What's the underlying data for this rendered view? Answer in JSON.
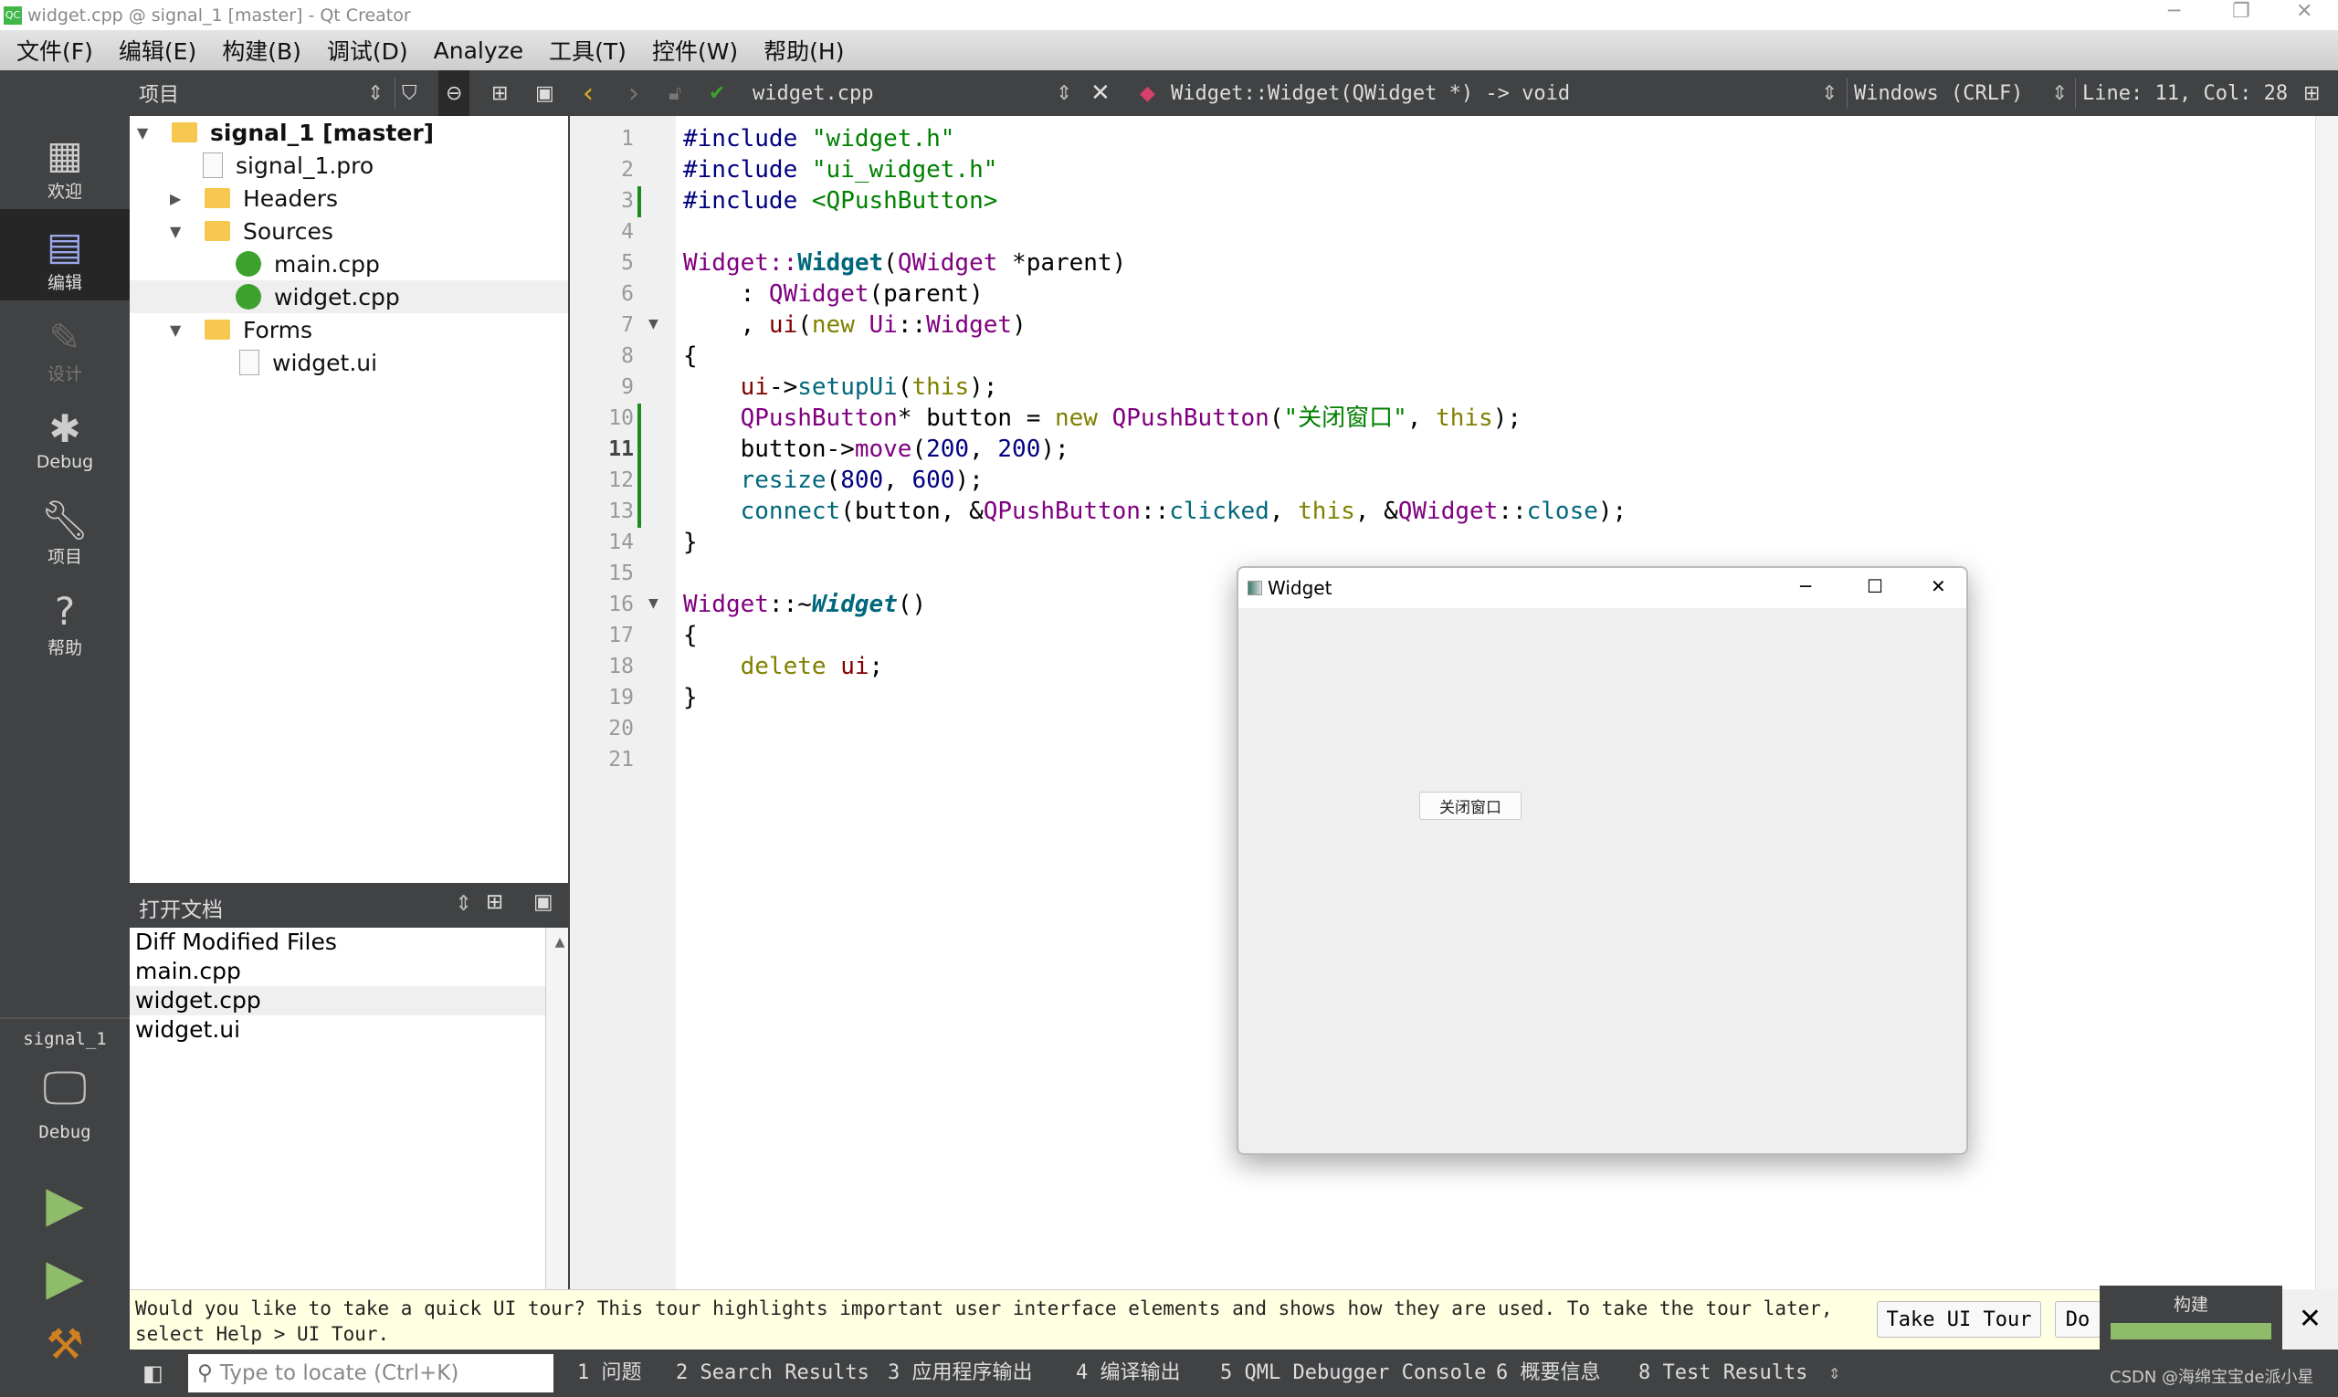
{
  "window": {
    "title": "widget.cpp @ signal_1 [master] - Qt Creator",
    "app_icon": "QC"
  },
  "menu": [
    "文件(F)",
    "编辑(E)",
    "构建(B)",
    "调试(D)",
    "Analyze",
    "工具(T)",
    "控件(W)",
    "帮助(H)"
  ],
  "toolbar": {
    "panel_title": "项目",
    "file_name": "widget.cpp",
    "symbol": "Widget::Widget(QWidget *) -> void",
    "line_ending": "Windows (CRLF)",
    "position": "Line: 11, Col: 28"
  },
  "modes": [
    {
      "label": "欢迎",
      "icon": "grid-icon"
    },
    {
      "label": "编辑",
      "icon": "edit-icon",
      "selected": true
    },
    {
      "label": "设计",
      "icon": "pencil-icon",
      "disabled": true
    },
    {
      "label": "Debug",
      "icon": "bug-icon"
    },
    {
      "label": "项目",
      "icon": "wrench-icon"
    },
    {
      "label": "帮助",
      "icon": "help-icon"
    }
  ],
  "kit": {
    "project": "signal_1",
    "config": "Debug"
  },
  "tree": [
    {
      "label": "signal_1 [master]",
      "level": 0,
      "expanded": true,
      "bold": true,
      "icon": "qt-project-folder-icon"
    },
    {
      "label": "signal_1.pro",
      "level": 1,
      "icon": "pro-file-icon"
    },
    {
      "label": "Headers",
      "level": 1,
      "expanded": false,
      "icon": "headers-folder-icon"
    },
    {
      "label": "Sources",
      "level": 1,
      "expanded": true,
      "icon": "sources-folder-icon"
    },
    {
      "label": "main.cpp",
      "level": 2,
      "icon": "cpp-file-icon"
    },
    {
      "label": "widget.cpp",
      "level": 2,
      "icon": "cpp-file-icon",
      "selected": true
    },
    {
      "label": "Forms",
      "level": 1,
      "expanded": true,
      "icon": "forms-folder-icon"
    },
    {
      "label": "widget.ui",
      "level": 2,
      "icon": "ui-file-icon"
    }
  ],
  "open_docs": {
    "title": "打开文档",
    "items": [
      "Diff Modified Files",
      "main.cpp",
      "widget.cpp",
      "widget.ui"
    ],
    "selected": 2
  },
  "code": {
    "current_line": 11,
    "lines": [
      [
        [
          "#include ",
          "pp"
        ],
        [
          "\"widget.h\"",
          "str"
        ]
      ],
      [
        [
          "#include ",
          "pp"
        ],
        [
          "\"ui_widget.h\"",
          "str"
        ]
      ],
      [
        [
          "#include ",
          "pp"
        ],
        [
          "<QPushButton>",
          "str"
        ]
      ],
      [],
      [
        [
          "Widget",
          "type"
        ],
        [
          "::",
          "type"
        ],
        [
          "Widget",
          "fnb"
        ],
        [
          "(",
          "def"
        ],
        [
          "QWidget",
          "type"
        ],
        [
          " *parent)",
          "def"
        ]
      ],
      [
        [
          "    : ",
          "def"
        ],
        [
          "QWidget",
          "type"
        ],
        [
          "(parent)",
          "def"
        ]
      ],
      [
        [
          "    , ",
          "def"
        ],
        [
          "ui",
          "mem"
        ],
        [
          "(",
          "def"
        ],
        [
          "new ",
          "kw"
        ],
        [
          "Ui",
          "type"
        ],
        [
          "::",
          "def"
        ],
        [
          "Widget",
          "type"
        ],
        [
          ")",
          "def"
        ]
      ],
      [
        [
          "{",
          "def"
        ]
      ],
      [
        [
          "    ",
          "def"
        ],
        [
          "ui",
          "mem"
        ],
        [
          "->",
          "def"
        ],
        [
          "setupUi",
          "fn"
        ],
        [
          "(",
          "def"
        ],
        [
          "this",
          "kw"
        ],
        [
          ");",
          "def"
        ]
      ],
      [
        [
          "    ",
          "def"
        ],
        [
          "QPushButton",
          "type"
        ],
        [
          "* button = ",
          "def"
        ],
        [
          "new ",
          "kw"
        ],
        [
          "QPushButton",
          "type"
        ],
        [
          "(",
          "def"
        ],
        [
          "\"关闭窗口\"",
          "str"
        ],
        [
          ", ",
          "def"
        ],
        [
          "this",
          "kw"
        ],
        [
          ");",
          "def"
        ]
      ],
      [
        [
          "    button->",
          "def"
        ],
        [
          "move",
          "type"
        ],
        [
          "(",
          "def"
        ],
        [
          "200",
          "num"
        ],
        [
          ", ",
          "def"
        ],
        [
          "200",
          "num"
        ],
        [
          ");",
          "def"
        ]
      ],
      [
        [
          "    ",
          "def"
        ],
        [
          "resize",
          "fn"
        ],
        [
          "(",
          "def"
        ],
        [
          "800",
          "num"
        ],
        [
          ", ",
          "def"
        ],
        [
          "600",
          "num"
        ],
        [
          ");",
          "def"
        ]
      ],
      [
        [
          "    ",
          "def"
        ],
        [
          "connect",
          "fn"
        ],
        [
          "(button, &",
          "def"
        ],
        [
          "QPushButton",
          "type"
        ],
        [
          "::",
          "def"
        ],
        [
          "clicked",
          "fn"
        ],
        [
          ", ",
          "def"
        ],
        [
          "this",
          "kw"
        ],
        [
          ", &",
          "def"
        ],
        [
          "QWidget",
          "type"
        ],
        [
          "::",
          "def"
        ],
        [
          "close",
          "fn"
        ],
        [
          ");",
          "def"
        ]
      ],
      [
        [
          "}",
          "def"
        ]
      ],
      [],
      [
        [
          "Widget",
          "type"
        ],
        [
          "::~",
          "def"
        ],
        [
          "Widget",
          "it"
        ],
        [
          "()",
          "def"
        ]
      ],
      [
        [
          "{",
          "def"
        ]
      ],
      [
        [
          "    ",
          "def"
        ],
        [
          "delete ",
          "kw"
        ],
        [
          "ui",
          "mem"
        ],
        [
          ";",
          "def"
        ]
      ],
      [
        [
          "}",
          "def"
        ]
      ],
      [],
      []
    ]
  },
  "widget_window": {
    "title": "Widget",
    "button": "关闭窗口"
  },
  "tour": {
    "message": "Would you like to take a quick UI tour? This tour highlights important user interface elements and shows how they are used. To take the tour later, select Help > UI Tour.",
    "take_button": "Take UI Tour",
    "dismiss_button": "Do"
  },
  "build_progress": {
    "label": "构建",
    "percent": 100,
    "color": "#8fbc6b"
  },
  "statusbar": {
    "locate_placeholder": "Type to locate (Ctrl+K)",
    "tabs": [
      "1  问题",
      "2  Search Results",
      "3  应用程序输出",
      "4  编译输出",
      "5  QML Debugger Console",
      "6  概要信息",
      "8  Test Results"
    ],
    "watermark": "CSDN @海绵宝宝de派小星"
  }
}
